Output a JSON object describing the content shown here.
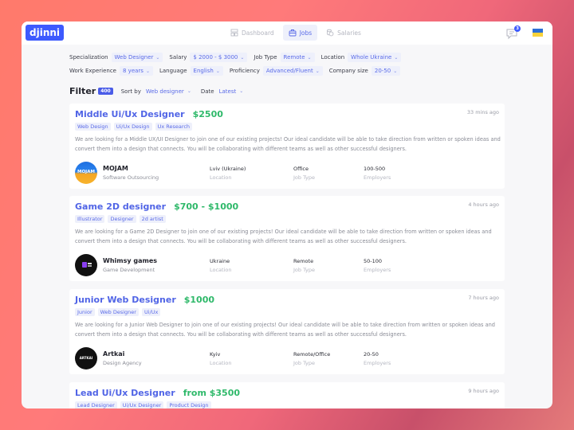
{
  "app": {
    "logo": "djinni",
    "nav": [
      {
        "label": "Dashboard",
        "icon": "dashboard-icon",
        "active": false
      },
      {
        "label": "Jobs",
        "icon": "briefcase-icon",
        "active": true
      },
      {
        "label": "Salaries",
        "icon": "coins-icon",
        "active": false
      }
    ],
    "messages_badge": "3",
    "language_flag": "ukraine-flag"
  },
  "filters": {
    "row1": [
      {
        "label": "Specialization",
        "value": "Web Designer"
      },
      {
        "label": "Salary",
        "value": "$ 2000 - $ 3000"
      },
      {
        "label": "Job Type",
        "value": "Remote"
      },
      {
        "label": "Location",
        "value": "Whole Ukraine"
      }
    ],
    "row2": [
      {
        "label": "Work Experience",
        "value": "8 years"
      },
      {
        "label": "Language",
        "value": "English"
      },
      {
        "label": "Proficiency",
        "value": "Advanced/Fluent"
      },
      {
        "label": "Company size",
        "value": "20-50"
      }
    ]
  },
  "filter_bar": {
    "title": "Filter",
    "count": "400",
    "sort_label": "Sort by",
    "sort_value": "Web designer",
    "date_label": "Date",
    "date_value": "Latest"
  },
  "meta_labels": {
    "location": "Location",
    "job_type": "Job Type",
    "employers": "Employers"
  },
  "jobs": [
    {
      "title": "Middle Ui/Ux Designer",
      "salary": "$2500",
      "time": "33 mins ago",
      "tags": [
        "Web Design",
        "Ui/Ux Design",
        "Ux Research"
      ],
      "description": "We are looking for a Middle UX/UI Designer to join one of our existing projects! Our ideal candidate will be able to take direction from written or spoken ideas and convert them into a design that connects. You will be collaborating with different teams as well as other successful designers.",
      "company": "MOJAM",
      "company_logo_text": "MOJAM",
      "company_type": "Software Outsourcing",
      "location": "Lviv (Ukraine)",
      "job_type": "Office",
      "employers": "100-500"
    },
    {
      "title": "Game 2D designer",
      "salary": "$700 - $1000",
      "time": "4 hours ago",
      "tags": [
        "Illustrator",
        "Designer",
        "2d artist"
      ],
      "description": "We are looking for a Game 2D Designer to join one of our existing projects! Our ideal candidate will be able to take direction from written or spoken ideas and convert them into a design that connects. You will be collaborating with different teams as well as other successful designers.",
      "company": "Whimsy games",
      "company_type": "Game Development",
      "location": "Ukraine",
      "job_type": "Remote",
      "employers": "50-100"
    },
    {
      "title": "Junior Web Designer",
      "salary": "$1000",
      "time": "7 hours ago",
      "tags": [
        "Junior",
        "Web Designer",
        "Ui/Ux"
      ],
      "description": "We are looking for a Junior Web Designer to join one of our existing projects! Our ideal candidate will be able to take direction from written or spoken ideas and convert them into a design that connects. You will be collaborating with different teams as well as other successful designers.",
      "company": "Artkai",
      "company_logo_text": "ARTKAI",
      "company_type": "Design Agency",
      "location": "Kyiv",
      "job_type": "Remote/Office",
      "employers": "20-50"
    },
    {
      "title": "Lead Ui/Ux Designer",
      "salary": "from $3500",
      "time": "9 hours ago",
      "tags": [
        "Lead Designer",
        "Ui/Ux Designer",
        "Product Design"
      ]
    }
  ]
}
